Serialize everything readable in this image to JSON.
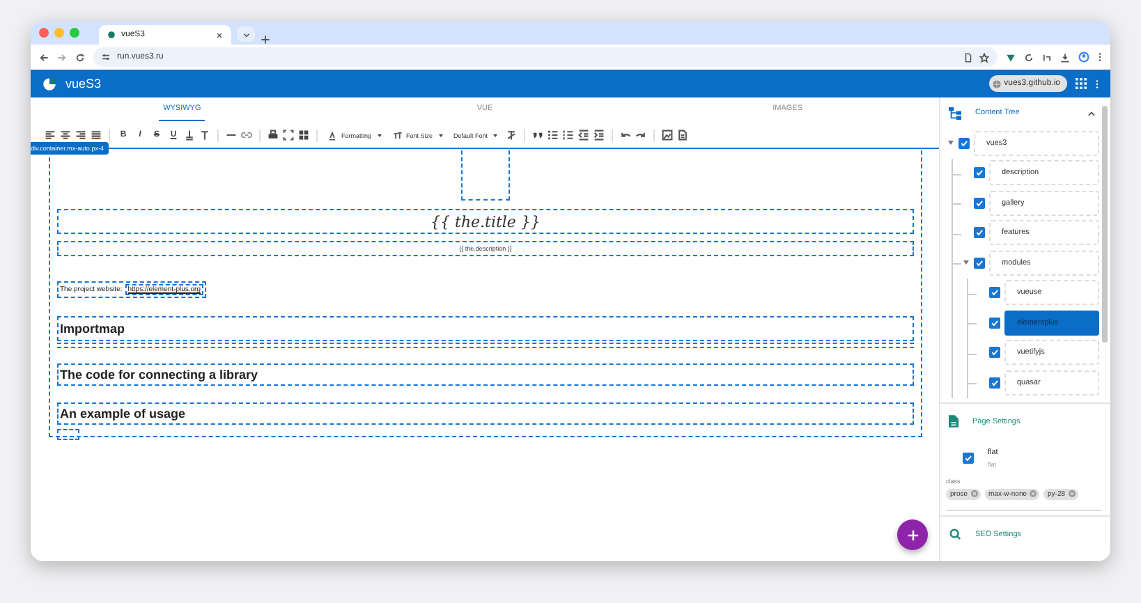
{
  "browser": {
    "tab_title": "vueS3",
    "url": "run.vues3.ru"
  },
  "app": {
    "title": "vueS3",
    "site_chip": "vues3.github.io"
  },
  "editor_tabs": [
    {
      "label": "WYSIWYG",
      "selected": true
    },
    {
      "label": "VUE",
      "selected": false
    },
    {
      "label": "IMAGES",
      "selected": false
    }
  ],
  "toolbar": {
    "format_buttons": [
      "B",
      "I",
      "S",
      "U"
    ],
    "dropdowns": [
      "Formatting",
      "Font Size",
      "Default Font"
    ]
  },
  "canvas": {
    "container_tag": "div.container.mx-auto.px-4",
    "title": "{{ the.title }}",
    "description": "{{ the.description }}",
    "paragraph": "The project website:",
    "link": "https://element-plus.org",
    "headings": [
      "Importmap",
      "The code for connecting a library",
      "An example of usage"
    ]
  },
  "content_tree": {
    "title": "Content Tree",
    "expanded": true,
    "nodes": [
      {
        "label": "vues3",
        "checked": true,
        "selected": false,
        "expanded": true,
        "children": [
          {
            "label": "description",
            "checked": true,
            "selected": false
          },
          {
            "label": "gallery",
            "checked": true,
            "selected": false
          },
          {
            "label": "features",
            "checked": true,
            "selected": false
          },
          {
            "label": "modules",
            "checked": true,
            "selected": false,
            "expanded": true,
            "children": [
              {
                "label": "vueuse",
                "checked": true,
                "selected": false
              },
              {
                "label": "elementplus",
                "checked": true,
                "selected": true
              },
              {
                "label": "vuetifyjs",
                "checked": true,
                "selected": false
              },
              {
                "label": "quasar",
                "checked": true,
                "selected": false
              }
            ]
          }
        ]
      }
    ]
  },
  "page_settings": {
    "title": "Page Settings",
    "flat": {
      "label": "flat",
      "caption": "flat",
      "checked": true
    },
    "class_label": "class",
    "classes": [
      "prose",
      "max-w-none",
      "py-28"
    ]
  },
  "seo_settings": {
    "title": "SEO Settings"
  }
}
